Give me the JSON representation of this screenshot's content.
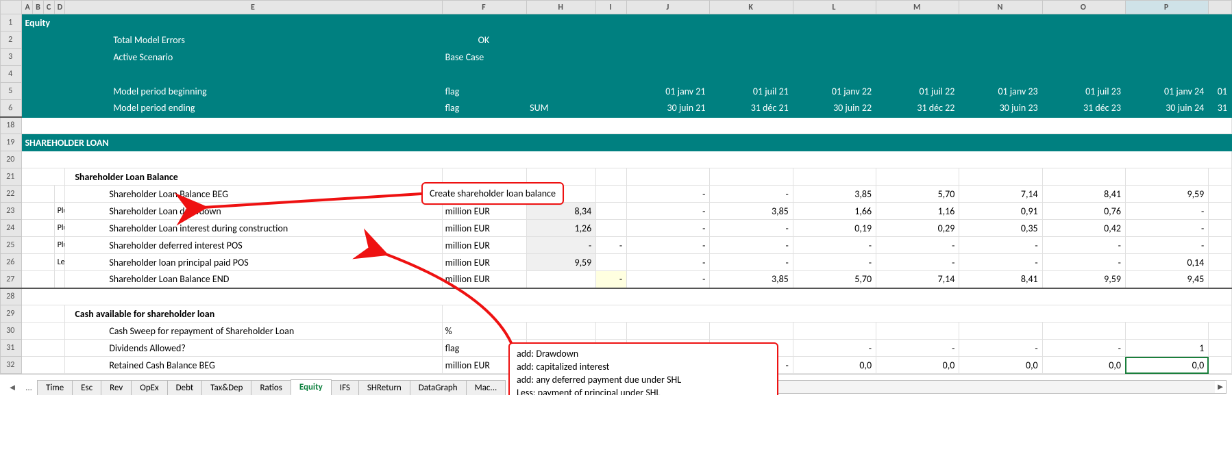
{
  "columns": [
    "",
    "A",
    "B",
    "C",
    "D",
    "E",
    "F",
    "H",
    "I",
    "J",
    "K",
    "L",
    "M",
    "N",
    "O",
    "P",
    ""
  ],
  "header": {
    "title": "Equity",
    "rows": [
      {
        "r": "1",
        "label": "Equity",
        "f": "",
        "h": ""
      },
      {
        "r": "2",
        "label": "Total Model Errors",
        "f": "OK",
        "h": ""
      },
      {
        "r": "3",
        "label": "Active Scenario",
        "f": "Base Case",
        "h": ""
      },
      {
        "r": "4",
        "label": "",
        "f": "",
        "h": ""
      },
      {
        "r": "5",
        "label": "Model period beginning",
        "f": "flag",
        "h": "",
        "dates": [
          "01 janv 21",
          "01 juil 21",
          "01 janv 22",
          "01 juil 22",
          "01 janv 23",
          "01 juil 23",
          "01 janv 24"
        ],
        "tail": "01"
      },
      {
        "r": "6",
        "label": "Model period ending",
        "f": "flag",
        "h": "SUM",
        "dates": [
          "30 juin 21",
          "31 déc 21",
          "30 juin 22",
          "31 déc 22",
          "30 juin 23",
          "31 déc 23",
          "30 juin 24"
        ],
        "tail": "31"
      }
    ]
  },
  "section_title": "SHAREHOLDER LOAN",
  "group_title": "Shareholder Loan Balance",
  "rows_visible": [
    "18",
    "19",
    "20",
    "21",
    "22",
    "23",
    "24",
    "25",
    "26",
    "27",
    "28",
    "29",
    "30",
    "31",
    "32"
  ],
  "lines": [
    {
      "r": "22",
      "pre": "",
      "label": "Shareholder Loan Balance BEG",
      "unit": "million EUR",
      "h": "",
      "i": "",
      "vals": [
        "-",
        "-",
        "3,85",
        "5,70",
        "7,14",
        "8,41",
        "9,59"
      ]
    },
    {
      "r": "23",
      "pre": "Plus",
      "label": "Shareholder Loan drawdown",
      "unit": "million EUR",
      "h": "8,34",
      "i": "",
      "vals": [
        "-",
        "3,85",
        "1,66",
        "1,16",
        "0,91",
        "0,76",
        "-"
      ],
      "shadeH": true
    },
    {
      "r": "24",
      "pre": "Plus",
      "label": "Shareholder Loan interest during construction",
      "unit": "million EUR",
      "h": "1,26",
      "i": "",
      "vals": [
        "-",
        "-",
        "0,19",
        "0,29",
        "0,35",
        "0,42",
        "-"
      ],
      "shadeH": true
    },
    {
      "r": "25",
      "pre": "Plus",
      "label": "Shareholder deferred interest POS",
      "unit": "million EUR",
      "h": "-",
      "i": "-",
      "vals": [
        "-",
        "-",
        "-",
        "-",
        "-",
        "-",
        "-"
      ],
      "shadeH": true
    },
    {
      "r": "26",
      "pre": "Less",
      "label": "Shareholder loan principal paid POS",
      "unit": "million EUR",
      "h": "9,59",
      "i": "",
      "vals": [
        "-",
        "-",
        "-",
        "-",
        "-",
        "-",
        "0,14"
      ],
      "shadeH": true
    },
    {
      "r": "27",
      "pre": "",
      "label": "Shareholder Loan Balance END",
      "unit": "million EUR",
      "h": "",
      "i": "-",
      "vals": [
        "-",
        "3,85",
        "5,70",
        "7,14",
        "8,41",
        "9,59",
        "9,45"
      ],
      "hlI": true
    }
  ],
  "cash_title": "Cash available for shareholder loan",
  "cash_lines": [
    {
      "r": "30",
      "label": "Cash Sweep for repayment of Shareholder Loan",
      "unit": "%",
      "h": "",
      "i": "",
      "vals": [
        "",
        "",
        "",
        "",
        "",
        "",
        ""
      ]
    },
    {
      "r": "31",
      "label": "Dividends Allowed?",
      "unit": "flag",
      "h": "",
      "i": "",
      "vals": [
        "",
        "",
        "-",
        "-",
        "-",
        "-",
        "1"
      ]
    },
    {
      "r": "32",
      "label": "Retained Cash Balance BEG",
      "unit": "million EUR",
      "h": "-",
      "i": "",
      "vals": [
        "-",
        "-",
        "0,0",
        "0,0",
        "0,0",
        "0,0",
        "0,0"
      ],
      "shadeH": true,
      "selP": true
    }
  ],
  "tabs": [
    "Time",
    "Esc",
    "Rev",
    "OpEx",
    "Debt",
    "Tax&Dep",
    "Ratios",
    "Equity",
    "IFS",
    "SHReturn",
    "DataGraph",
    "Mac..."
  ],
  "active_tab": "Equity",
  "nav_dots": "...",
  "callout1": "Create shareholder loan balance",
  "callout2_lines": [
    "add: Drawdown",
    "add: capitalized interest",
    "add: any deferred payment due under SHL",
    "Less: payment of principal under SHL"
  ]
}
